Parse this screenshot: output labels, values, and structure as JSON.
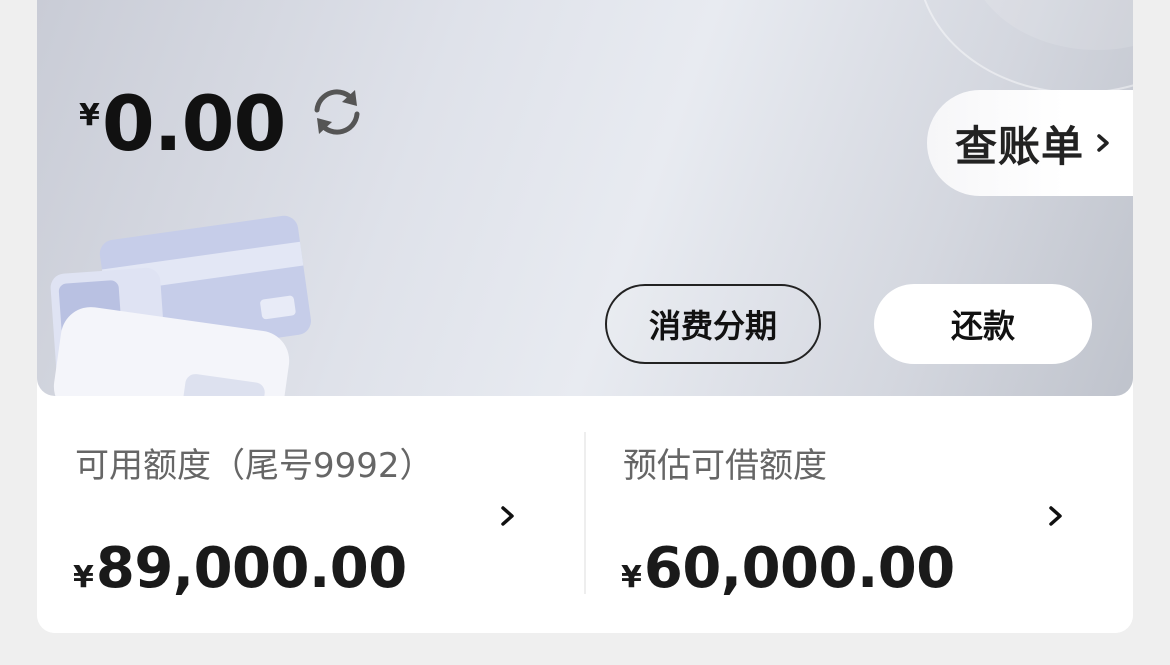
{
  "balance": {
    "currency": "¥",
    "amount": "0.00"
  },
  "bill_button": {
    "label": "查账单"
  },
  "actions": {
    "installment_label": "消费分期",
    "repay_label": "还款"
  },
  "available_credit": {
    "title": "可用额度（尾号9992）",
    "currency": "¥",
    "amount": "89,000.00"
  },
  "estimated_loan": {
    "title": "预估可借额度",
    "currency": "¥",
    "amount": "60,000.00"
  },
  "icons": {
    "refresh": "refresh-icon",
    "chevron": "chevron-right-icon",
    "illustration": "credit-cards-illustration"
  },
  "colors": {
    "background": "#efefef",
    "card": "#ffffff",
    "text_primary": "#111111",
    "text_secondary": "#666666"
  }
}
